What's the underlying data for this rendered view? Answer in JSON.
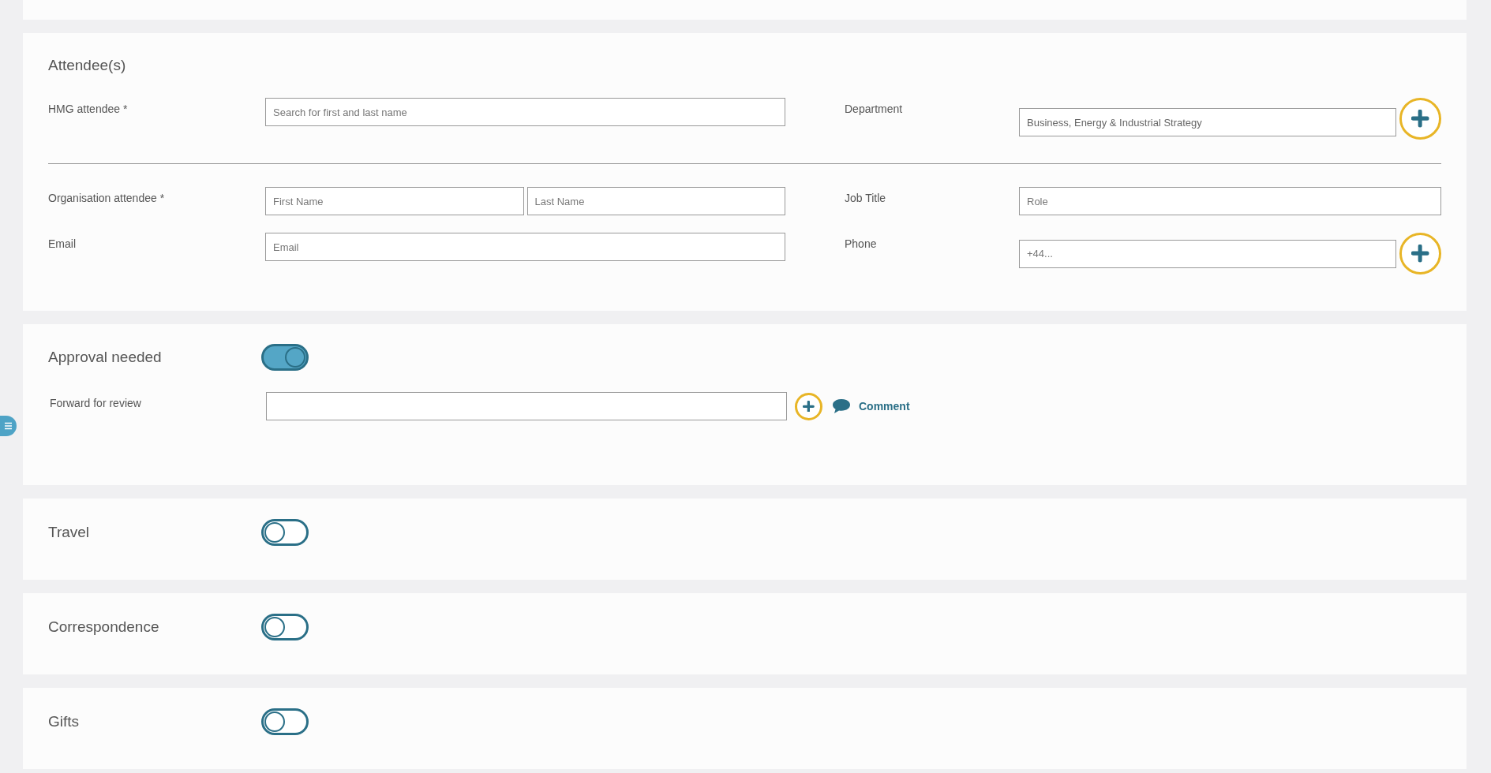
{
  "attendees": {
    "title": "Attendee(s)",
    "hmg": {
      "label": "HMG attendee *",
      "placeholder": "Search for first and last name",
      "right_label": "Department",
      "right_value": "Business, Energy & Industrial Strategy"
    },
    "organisation": {
      "label": "Organisation attendee *",
      "first_placeholder": "First Name",
      "last_placeholder": "Last Name",
      "right_label": "Job Title",
      "right_placeholder": "Role"
    },
    "email": {
      "label": "Email",
      "placeholder": "Email",
      "right_label": "Phone",
      "right_placeholder": "+44..."
    }
  },
  "approval": {
    "title": "Approval needed",
    "on": true,
    "forward_label": "Forward for review",
    "comment": "Comment"
  },
  "sections": [
    {
      "title": "Travel",
      "on": false
    },
    {
      "title": "Correspondence",
      "on": false
    },
    {
      "title": "Gifts",
      "on": false
    }
  ]
}
